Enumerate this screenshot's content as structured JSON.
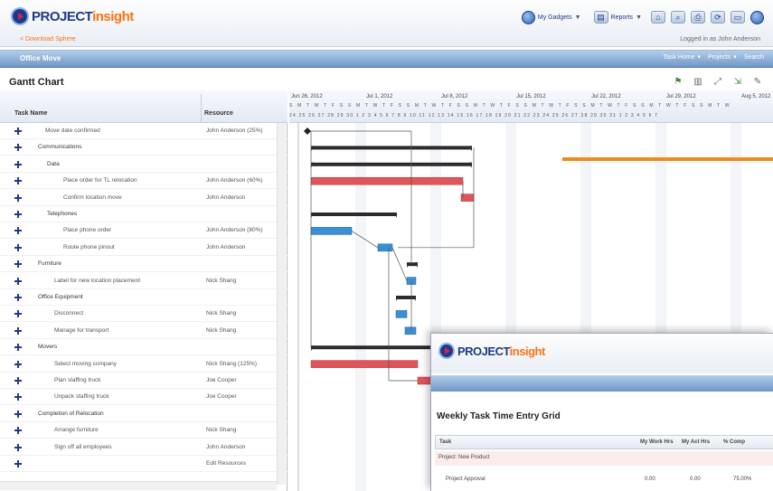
{
  "app": {
    "brand_main": "PROJECT",
    "brand_accent": "insight",
    "sub_link": "< Download Sphere",
    "user_text": "Logged in as John Anderson",
    "header_tools": [
      {
        "label": "My Gadgets"
      },
      {
        "label": "Reports"
      }
    ]
  },
  "bluebar": {
    "title": "Office Move",
    "right_items": [
      "Task Home",
      "Projects",
      "Search"
    ]
  },
  "gantt": {
    "title": "Gantt Chart",
    "columns": {
      "task": "Task Name",
      "resource": "Resource"
    },
    "rows": [
      {
        "name": "Move date confirmed",
        "resource": "John Anderson (25%)",
        "indent": 1,
        "summary": false
      },
      {
        "name": "Communications",
        "resource": "",
        "indent": 1,
        "summary": true
      },
      {
        "name": "Data",
        "resource": "",
        "indent": 2,
        "summary": true
      },
      {
        "name": "Place order for TL relocation",
        "resource": "John Anderson (60%)",
        "indent": 3,
        "summary": false
      },
      {
        "name": "Confirm location move",
        "resource": "John Anderson",
        "indent": 3,
        "summary": false
      },
      {
        "name": "Telephones",
        "resource": "",
        "indent": 2,
        "summary": true
      },
      {
        "name": "Place phone order",
        "resource": "John Anderson (80%)",
        "indent": 3,
        "summary": false
      },
      {
        "name": "Route phone pinout",
        "resource": "John Anderson",
        "indent": 3,
        "summary": false
      },
      {
        "name": "Furniture",
        "resource": "",
        "indent": 1,
        "summary": true
      },
      {
        "name": "Label for new location placement",
        "resource": "Nick Shang",
        "indent": 2,
        "summary": false
      },
      {
        "name": "Office Equipment",
        "resource": "",
        "indent": 1,
        "summary": true
      },
      {
        "name": "Disconnect",
        "resource": "Nick Shang",
        "indent": 2,
        "summary": false
      },
      {
        "name": "Manage for transport",
        "resource": "Nick Shang",
        "indent": 2,
        "summary": false
      },
      {
        "name": "Movers",
        "resource": "",
        "indent": 1,
        "summary": true
      },
      {
        "name": "Select moving company",
        "resource": "Nick Shang (125%)",
        "indent": 2,
        "summary": false
      },
      {
        "name": "Plan staffing truck",
        "resource": "Joe Cooper",
        "indent": 2,
        "summary": false
      },
      {
        "name": "Unpack staffing truck",
        "resource": "Joe Cooper",
        "indent": 2,
        "summary": false
      },
      {
        "name": "Completion of Relocation",
        "resource": "",
        "indent": 1,
        "summary": true
      },
      {
        "name": "Arrange furniture",
        "resource": "Nick Shang",
        "indent": 2,
        "summary": false
      },
      {
        "name": "Sign off all employees",
        "resource": "John Anderson",
        "indent": 2,
        "summary": false
      },
      {
        "name": "",
        "resource": "Edit Resources",
        "indent": 2,
        "summary": false
      }
    ],
    "timeline": {
      "weeks": [
        "Jun 26, 2012",
        "Jul 1, 2012",
        "Jul 8, 2012",
        "Jul 15, 2012",
        "Jul 22, 2012",
        "Jul 29, 2012",
        "Aug 5, 2012"
      ],
      "day_letters": "S M T W T F S S M T W T F S S M T W T F S S M T W T F S S M T W T F S S M T W T F S S M T W T F S S M T W",
      "day_numbers": "24 25 26 27 28 29 30 1 2 3 4 5 6 7 8 9 10 11 12 13 14 15 16 17 18 19 20 21 22 23 24 25 26 27 28 29 30 31 1 2 3 4 5 6 7"
    }
  },
  "overlay": {
    "brand_main": "PROJECT",
    "brand_accent": "insight",
    "title": "Weekly Task Time Entry Grid",
    "columns": [
      "Task",
      "My Work Hrs",
      "My Act Hrs",
      "% Comp"
    ],
    "group": "Project: New Product",
    "row": {
      "task": "Project Approval",
      "work": "0.00",
      "act": "0.00",
      "comp": "75.00%"
    }
  },
  "colors": {
    "summary_bar": "#2b2b2b",
    "critical_bar": "#e0555a",
    "task_bar": "#3b8fd6",
    "annotation": "#f28a1a"
  }
}
